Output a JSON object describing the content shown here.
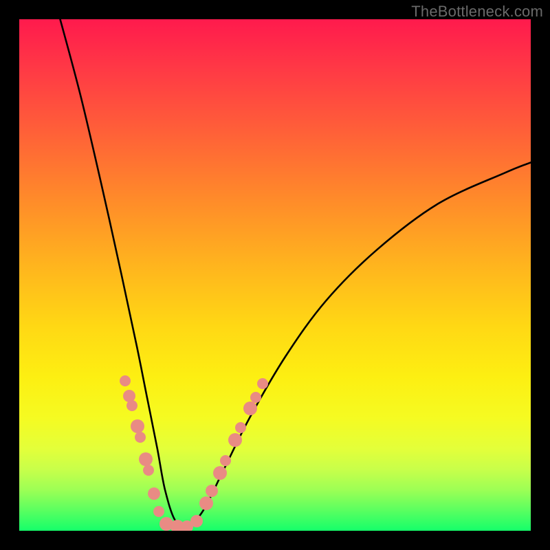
{
  "watermark": "TheBottleneck.com",
  "chart_data": {
    "type": "line",
    "title": "",
    "xlabel": "",
    "ylabel": "",
    "xlim": [
      0,
      100
    ],
    "ylim": [
      0,
      100
    ],
    "series": [
      {
        "name": "curve",
        "x": [
          8,
          12,
          16,
          20,
          23,
          25,
          27,
          28.5,
          30.5,
          33,
          36,
          40,
          45,
          52,
          60,
          70,
          82,
          95,
          100
        ],
        "y": [
          100,
          85,
          68,
          50,
          36,
          26,
          16,
          8,
          2,
          1,
          4,
          12,
          22,
          34,
          45,
          55,
          64,
          70,
          72
        ]
      }
    ],
    "markers": [
      {
        "u": 154,
        "v": 526,
        "r": 8
      },
      {
        "u": 160,
        "v": 548,
        "r": 9
      },
      {
        "u": 164,
        "v": 562,
        "r": 8
      },
      {
        "u": 172,
        "v": 592,
        "r": 10
      },
      {
        "u": 176,
        "v": 608,
        "r": 8
      },
      {
        "u": 184,
        "v": 640,
        "r": 10
      },
      {
        "u": 188,
        "v": 656,
        "r": 8
      },
      {
        "u": 196,
        "v": 690,
        "r": 9
      },
      {
        "u": 203,
        "v": 716,
        "r": 8
      },
      {
        "u": 214,
        "v": 734,
        "r": 10
      },
      {
        "u": 230,
        "v": 738,
        "r": 10
      },
      {
        "u": 244,
        "v": 738,
        "r": 9
      },
      {
        "u": 258,
        "v": 730,
        "r": 9
      },
      {
        "u": 272,
        "v": 704,
        "r": 10
      },
      {
        "u": 280,
        "v": 686,
        "r": 9
      },
      {
        "u": 292,
        "v": 660,
        "r": 10
      },
      {
        "u": 300,
        "v": 642,
        "r": 8
      },
      {
        "u": 314,
        "v": 612,
        "r": 10
      },
      {
        "u": 322,
        "v": 594,
        "r": 8
      },
      {
        "u": 336,
        "v": 566,
        "r": 10
      },
      {
        "u": 344,
        "v": 550,
        "r": 8
      },
      {
        "u": 354,
        "v": 530,
        "r": 8
      }
    ],
    "marker_color": "#e98b84",
    "curve_color": "#000000"
  }
}
